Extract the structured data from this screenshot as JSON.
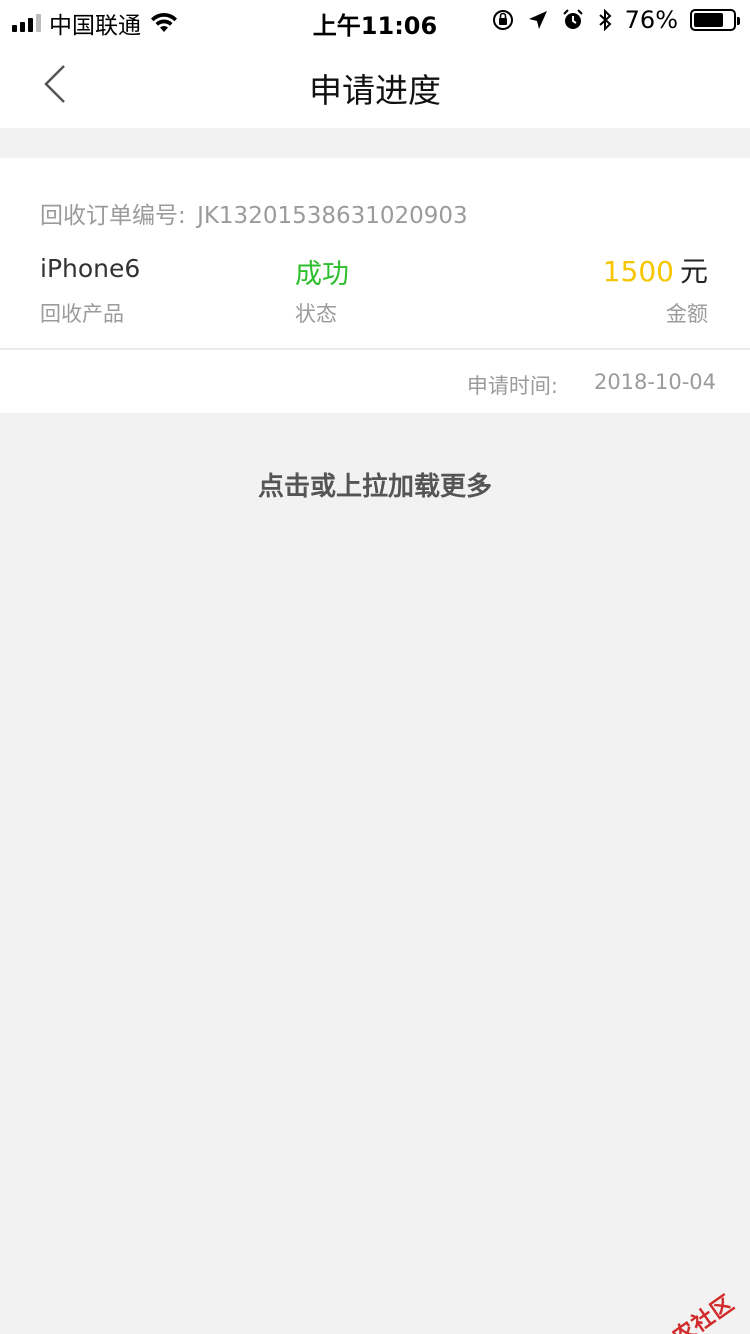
{
  "status_bar": {
    "carrier": "中国联通",
    "time": "上午11:06",
    "battery_percent": "76%",
    "battery_level": 0.76
  },
  "nav": {
    "title": "申请进度",
    "back_icon": "chevron-left-icon"
  },
  "order": {
    "number_label": "回收订单编号:",
    "number": "JK13201538631020903",
    "product_name": "iPhone6",
    "product_label": "回收产品",
    "status": "成功",
    "status_label": "状态",
    "amount": "1500",
    "amount_unit": "元",
    "amount_label": "金额",
    "apply_time_label": "申请时间:",
    "apply_time": "2018-10-04"
  },
  "load_more": "点击或上拉加载更多",
  "watermark": "卡农社区",
  "colors": {
    "status_success": "#2dbf2d",
    "amount": "#f7c600",
    "background": "#f2f2f2"
  }
}
